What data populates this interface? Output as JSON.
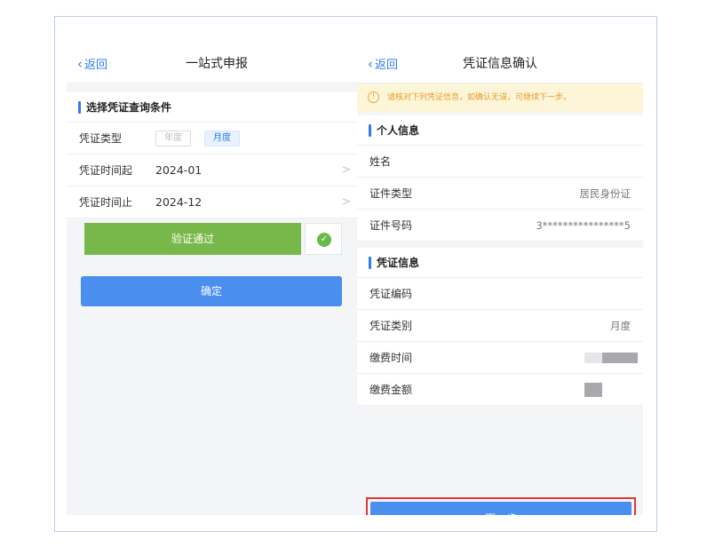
{
  "left_screen": {
    "back_label": "返回",
    "title": "一站式申报",
    "section_title": "选择凭证查询条件",
    "type_row": {
      "label": "凭证类型",
      "options": [
        "年度",
        "月度"
      ],
      "selected": "月度"
    },
    "start_row": {
      "label": "凭证时间起",
      "value": "2024-01"
    },
    "end_row": {
      "label": "凭证时间止",
      "value": "2024-12"
    },
    "verify_label": "验证通过",
    "confirm_label": "确定"
  },
  "right_screen": {
    "back_label": "返回",
    "title": "凭证信息确认",
    "notice": "请核对下列凭证信息，如确认无误，可继续下一步。",
    "personal_section": "个人信息",
    "personal_rows": [
      {
        "label": "姓名",
        "value": ""
      },
      {
        "label": "证件类型",
        "value": "居民身份证"
      },
      {
        "label": "证件号码",
        "value": "3****************5"
      }
    ],
    "voucher_section": "凭证信息",
    "voucher_rows": [
      {
        "label": "凭证编码",
        "value": ""
      },
      {
        "label": "凭证类别",
        "value": "月度"
      },
      {
        "label": "缴费时间",
        "value": ""
      },
      {
        "label": "缴费金额",
        "value": ""
      }
    ],
    "next_label": "下一步"
  },
  "colors": {
    "accent": "#2f7cf0",
    "button_blue": "#4a8ff0",
    "verify_green": "#78b84a",
    "highlight_red": "#e63535",
    "notice_bg": "#fdf5d7"
  },
  "icons": [
    "chevron-left-icon",
    "chevron-right-icon",
    "check-circle-icon",
    "info-circle-icon"
  ]
}
